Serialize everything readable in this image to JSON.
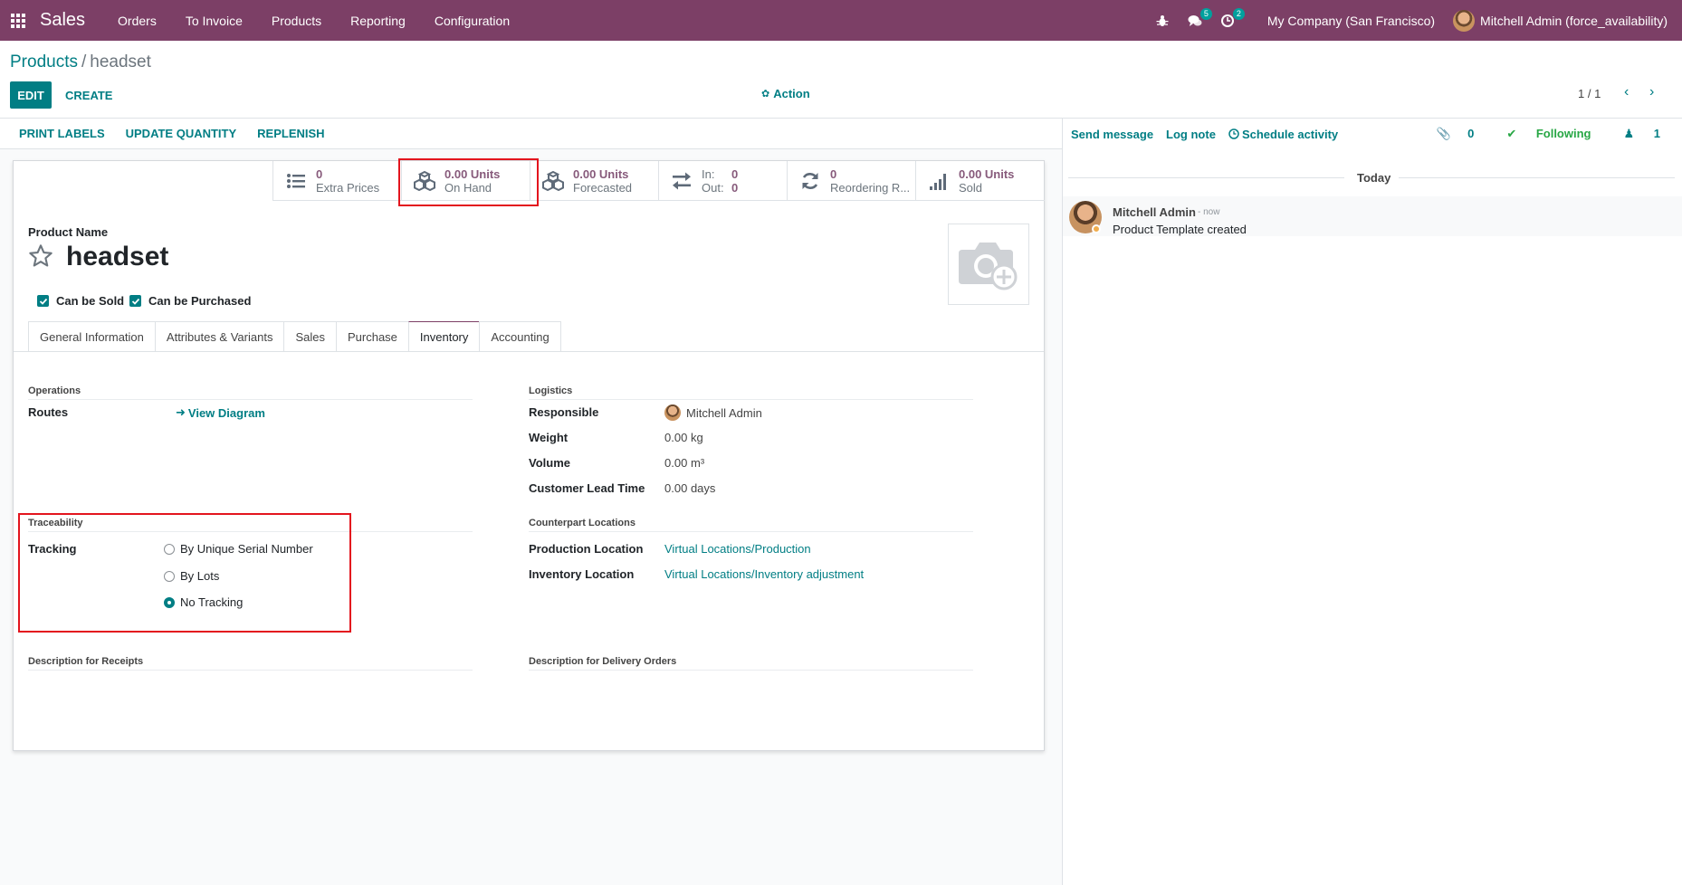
{
  "navbar": {
    "app_name": "Sales",
    "menu": [
      "Orders",
      "To Invoice",
      "Products",
      "Reporting",
      "Configuration"
    ],
    "messages_count": "5",
    "activities_count": "2",
    "company": "My Company (San Francisco)",
    "user": "Mitchell Admin (force_availability)"
  },
  "breadcrumb": {
    "parent": "Products",
    "separator": "/",
    "current": "headset"
  },
  "control": {
    "edit": "EDIT",
    "create": "CREATE",
    "action": "Action",
    "pager": "1 / 1"
  },
  "statusbar": {
    "buttons": [
      "PRINT LABELS",
      "UPDATE QUANTITY",
      "REPLENISH"
    ]
  },
  "smart_buttons": {
    "extra_prices": {
      "value": "0",
      "label": "Extra Prices"
    },
    "on_hand": {
      "value": "0.00 Units",
      "label": "On Hand"
    },
    "forecasted": {
      "value": "0.00 Units",
      "label": "Forecasted"
    },
    "in_out": {
      "in_label": "In:",
      "in_value": "0",
      "out_label": "Out:",
      "out_value": "0"
    },
    "reordering": {
      "value": "0",
      "label": "Reordering R..."
    },
    "sold": {
      "value": "0.00 Units",
      "label": "Sold"
    }
  },
  "product": {
    "name_label": "Product Name",
    "name": "headset",
    "can_be_sold": "Can be Sold",
    "can_be_purchased": "Can be Purchased"
  },
  "tabs": [
    "General Information",
    "Attributes & Variants",
    "Sales",
    "Purchase",
    "Inventory",
    "Accounting"
  ],
  "inventory": {
    "operations_title": "Operations",
    "routes_label": "Routes",
    "view_diagram": "View Diagram",
    "logistics_title": "Logistics",
    "responsible_label": "Responsible",
    "responsible_value": "Mitchell Admin",
    "weight_label": "Weight",
    "weight_value": "0.00",
    "weight_unit": "kg",
    "volume_label": "Volume",
    "volume_value": "0.00",
    "volume_unit": "m³",
    "lead_label": "Customer Lead Time",
    "lead_value": "0.00",
    "lead_unit": "days",
    "traceability_title": "Traceability",
    "tracking_label": "Tracking",
    "tracking_options": [
      "By Unique Serial Number",
      "By Lots",
      "No Tracking"
    ],
    "tracking_selected": "No Tracking",
    "counterpart_title": "Counterpart Locations",
    "production_label": "Production Location",
    "production_value": "Virtual Locations/Production",
    "inventory_label": "Inventory Location",
    "inventory_value": "Virtual Locations/Inventory adjustment",
    "desc_receipts": "Description for Receipts",
    "desc_delivery": "Description for Delivery Orders"
  },
  "chatter": {
    "send_message": "Send message",
    "log_note": "Log note",
    "schedule_activity": "Schedule activity",
    "attachments": "0",
    "following": "Following",
    "followers": "1",
    "today": "Today",
    "message": {
      "author": "Mitchell Admin",
      "date": "- now",
      "body": "Product Template created"
    }
  },
  "colors": {
    "brand": "#7c3f66",
    "accent": "#017e84",
    "highlight": "#e3151e"
  }
}
